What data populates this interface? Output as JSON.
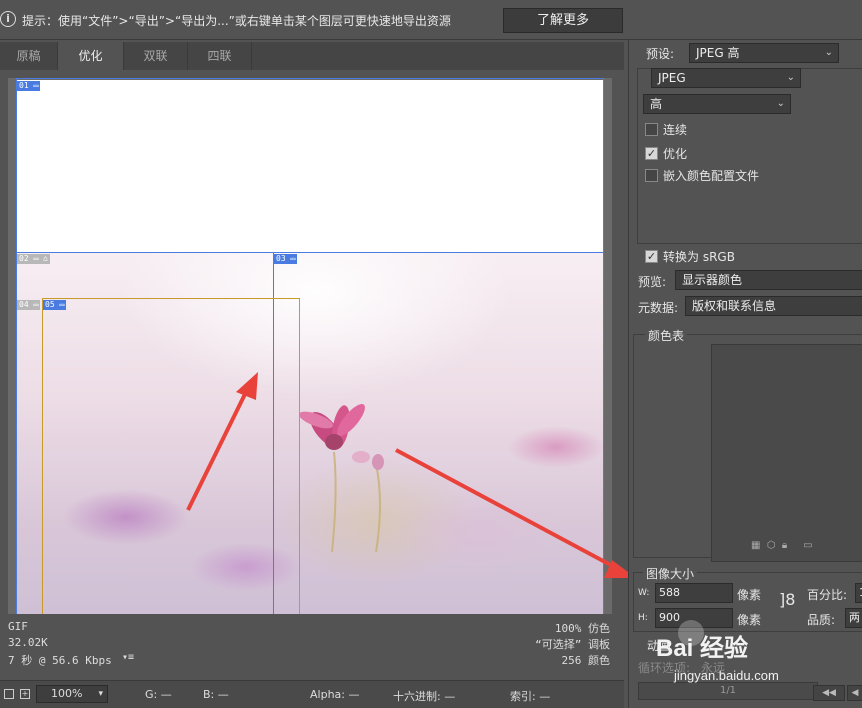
{
  "topbar": {
    "info_icon": "i",
    "tip": "提示：使用“文件”>“导出”>“导出为...”或右键单击某个图层可更快速地导出资源",
    "learn_more": "了解更多"
  },
  "tabs": [
    {
      "label": "原稿",
      "active": false
    },
    {
      "label": "优化",
      "active": true
    },
    {
      "label": "双联",
      "active": false
    },
    {
      "label": "四联",
      "active": false
    }
  ],
  "slices": {
    "tag01": "01",
    "tag02": "02",
    "tag03": "03",
    "tag04": "04",
    "tag05": "05"
  },
  "status": {
    "format": "GIF",
    "size": "32.02K",
    "time": "7 秒 @ 56.6 Kbps",
    "dither": "100% 仿色",
    "palette": "“可选择” 调板",
    "colors": "256 颜色"
  },
  "bottombar": {
    "zoom": "100%",
    "g": "G: —",
    "b": "B: —",
    "alpha": "Alpha: —",
    "hex": "十六进制: —",
    "index": "索引: —"
  },
  "panel": {
    "preset_label": "预设:",
    "preset_value": "JPEG 高",
    "format_value": "JPEG",
    "quality_value": "高",
    "progressive": "连续",
    "optimized": "优化",
    "embed_profile": "嵌入颜色配置文件",
    "convert_srgb": "转换为 sRGB",
    "preview_label": "预览:",
    "preview_value": "显示器颜色",
    "metadata_label": "元数据:",
    "metadata_value": "版权和联系信息",
    "color_table": "颜色表",
    "image_size": "图像大小",
    "w_label": "W:",
    "w_value": "588",
    "h_label": "H:",
    "h_value": "900",
    "px1": "像素",
    "px2": "像素",
    "percent_label": "百分比:",
    "percent_value": "1",
    "quality_label": "品质:",
    "quality_value2": "两",
    "animation": "动画",
    "loop_label": "循环选项:",
    "loop_value": "永远",
    "frame": "1/1"
  },
  "watermark": {
    "brand": "Bai 经验",
    "url": "jingyan.baidu.com"
  },
  "colors": {
    "accent_blue": "#4a7be0",
    "arrow_red": "#e8423a",
    "selection": "#c89a2a"
  }
}
